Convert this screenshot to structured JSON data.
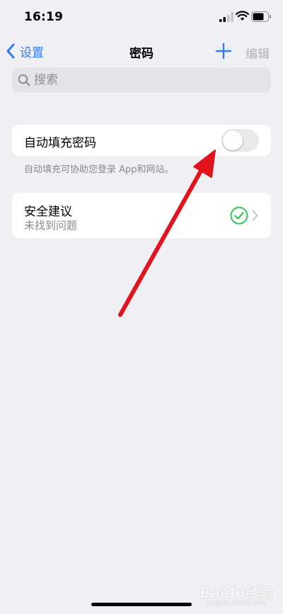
{
  "status_bar": {
    "time": "16:19"
  },
  "nav": {
    "back_label": "设置",
    "title": "密码",
    "edit_label": "编辑"
  },
  "search": {
    "placeholder": "搜索"
  },
  "autofill": {
    "label": "自动填充密码",
    "enabled": false,
    "footnote": "自动填充可协助您登录 App和网站。"
  },
  "security": {
    "title": "安全建议",
    "subtitle": "未找到问题"
  },
  "watermark": {
    "text": "Baidu经验",
    "subtext": "jingyan.baidu.com"
  },
  "colors": {
    "accent": "#2f7bf6",
    "arrow": "#e0141c",
    "check": "#34c759",
    "background": "#efeff4"
  },
  "icons": [
    "chevron-left-icon",
    "plus-icon",
    "search-icon",
    "green-check-icon",
    "chevron-right-icon",
    "cellular-signal-icon",
    "wifi-icon",
    "battery-icon"
  ]
}
